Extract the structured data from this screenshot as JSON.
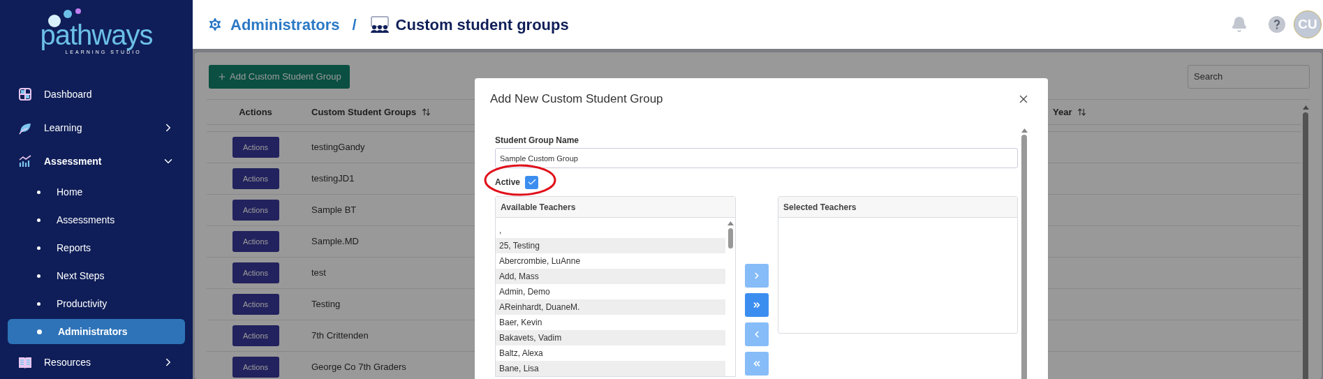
{
  "sidebar": {
    "logo": {
      "name": "pathways",
      "tagline": "LEARNING STUDIO"
    },
    "items": [
      {
        "kind": "link",
        "label": "Dashboard"
      },
      {
        "kind": "group",
        "label": "Learning",
        "expanded": false
      },
      {
        "kind": "group",
        "label": "Assessment",
        "expanded": true,
        "children": [
          {
            "label": "Home",
            "selected": false
          },
          {
            "label": "Assessments",
            "selected": false
          },
          {
            "label": "Reports",
            "selected": false
          },
          {
            "label": "Next Steps",
            "selected": false
          },
          {
            "label": "Productivity",
            "selected": false
          },
          {
            "label": "Administrators",
            "selected": true
          }
        ]
      },
      {
        "kind": "group",
        "label": "Resources",
        "expanded": false
      }
    ]
  },
  "header": {
    "breadcrumb": [
      {
        "label": "Administrators"
      },
      {
        "label": "Custom student groups"
      }
    ],
    "separator": "/",
    "avatar": "CU"
  },
  "table": {
    "add_button": "Add Custom Student Group",
    "search": {
      "placeholder": "Search"
    },
    "columns": [
      {
        "label": "Actions",
        "sortable": false
      },
      {
        "label": "Custom Student Groups",
        "sortable": true
      },
      {
        "label": "Year",
        "sortable": true
      }
    ],
    "rows": [
      {
        "action": "Actions",
        "name": "testingGandy"
      },
      {
        "action": "Actions",
        "name": "testingJD1"
      },
      {
        "action": "Actions",
        "name": "Sample BT"
      },
      {
        "action": "Actions",
        "name": "Sample.MD"
      },
      {
        "action": "Actions",
        "name": "test"
      },
      {
        "action": "Actions",
        "name": "Testing"
      },
      {
        "action": "Actions",
        "name": "7th Crittenden"
      },
      {
        "action": "Actions",
        "name": "George Co 7th Graders"
      }
    ]
  },
  "modal": {
    "title": "Add New Custom Student Group",
    "name_label": "Student Group Name",
    "name_value": "Sample Custom Group",
    "active_label": "Active",
    "active_checked": true,
    "available_title": "Available Teachers",
    "available": [
      ",",
      "25, Testing",
      "Abercrombie, LuAnne",
      "Add, Mass",
      "Admin, Demo",
      "AReinhardt, DuaneM.",
      "Baer, Kevin",
      "Bakavets, Vadim",
      "Baltz, Alexa",
      "Bane, Lisa"
    ],
    "selected_title": "Selected Teachers",
    "transfer_buttons": [
      {
        "disabled": true
      },
      {
        "disabled": false
      },
      {
        "disabled": true
      },
      {
        "disabled": true
      }
    ]
  }
}
